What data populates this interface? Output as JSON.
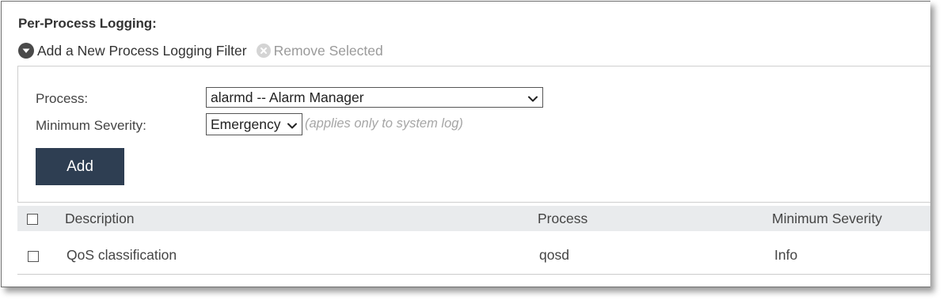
{
  "section": {
    "title": "Per-Process Logging:"
  },
  "toolbar": {
    "add_label": "Add a New Process Logging Filter",
    "remove_label": "Remove Selected",
    "add_icon": "chevron-down-circle-icon",
    "remove_icon": "x-circle-icon"
  },
  "form": {
    "process_label": "Process:",
    "process_value": "alarmd -- Alarm Manager",
    "severity_label": "Minimum Severity:",
    "severity_value": "Emergency",
    "severity_hint": "(applies only to system log)",
    "add_button": "Add"
  },
  "table": {
    "headers": {
      "description": "Description",
      "process": "Process",
      "severity": "Minimum Severity"
    },
    "rows": [
      {
        "description": "QoS classification",
        "process": "qosd",
        "severity": "Info",
        "checked": false
      }
    ]
  },
  "colors": {
    "add_button_bg": "#2e3e52",
    "header_bg": "#e9ebed",
    "hint_text": "#a6a6a6",
    "disabled_text": "#9a9a9a"
  }
}
